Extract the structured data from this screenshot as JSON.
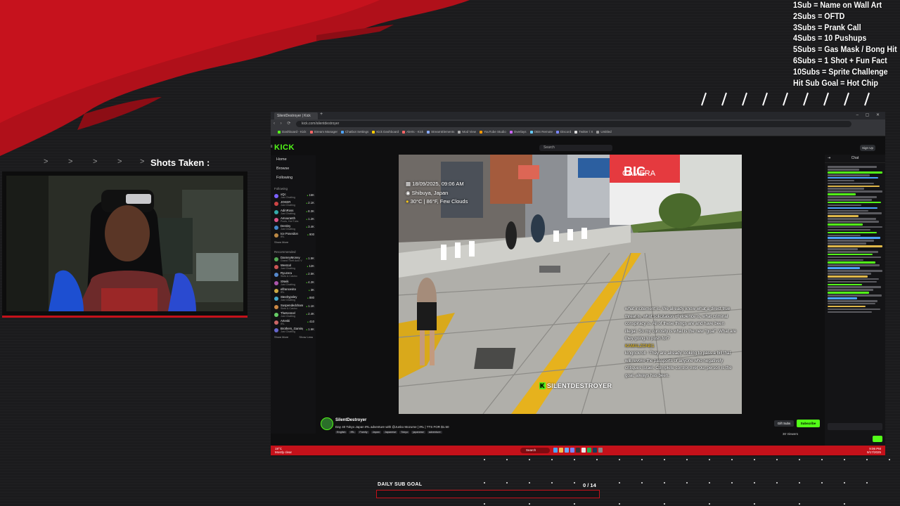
{
  "overlay": {
    "sub_menu": [
      "1Sub = Name on Wall Art",
      "2Subs = OFTD",
      "3Subs = Prank Call",
      "4Subs = 10 Pushups",
      "5Subs = Gas Mask / Bong Hit",
      "6Subs = 1 Shot + Fun Fact",
      "10Subs =  Sprite Challenge",
      "Hit Sub Goal  = Hot Chip"
    ],
    "shots_label": "Shots Taken :",
    "goal_label": "DAILY SUB GOAL",
    "goal_count": "0 / 14",
    "goal_current": 0,
    "goal_target": 14,
    "accent_color": "#c4111a"
  },
  "browser": {
    "tab_title": "SilentDestroyer | Kick",
    "url": "kick.com/silentdestroyer",
    "bookmarks": [
      "Dashboard - Kick",
      "Stream Manager",
      "Chatbot Settings",
      "Kick Dashboard",
      "Alerts - Kick",
      "StreamElements",
      "Mod View",
      "YouTube Studio",
      "Overlays",
      "OBS Remote",
      "Discord",
      "Twitter / X",
      "Untitled"
    ]
  },
  "kick": {
    "logo": "KICK",
    "search_placeholder": "Search",
    "sign_in": "Sign Up",
    "nav": [
      "Home",
      "Browse",
      "Following"
    ],
    "following_label": "Following",
    "recommended_label": "Recommended",
    "show_more": "Show More",
    "show_less": "Show Less",
    "following": [
      {
        "name": "xQc",
        "game": "Just Chatting",
        "viewers": "16K",
        "color": "#7b61ff"
      },
      {
        "name": "JOKER",
        "game": "Just Chatting",
        "viewers": "2.1K",
        "color": "#c44"
      },
      {
        "name": "AdinRoss",
        "game": "Just Chatting",
        "viewers": "8.3K",
        "color": "#3aa"
      },
      {
        "name": "Amouranth",
        "game": "Pools, Hot Tubs",
        "viewers": "1.2K",
        "color": "#d58"
      },
      {
        "name": "Destiny",
        "game": "Just Chatting",
        "viewers": "3.4K",
        "color": "#48c"
      },
      {
        "name": "Ice Poseidon",
        "game": "IRL",
        "viewers": "900",
        "color": "#b84"
      }
    ],
    "recommended": [
      {
        "name": "DanneyMoney",
        "game": "Grand Theft Auto V",
        "viewers": "1.5K",
        "color": "#5a5"
      },
      {
        "name": "Westcol",
        "game": "Just Chatting",
        "viewers": "12K",
        "color": "#c55"
      },
      {
        "name": "Ryuzera",
        "game": "Slots & Casino",
        "viewers": "2.5K",
        "color": "#58c"
      },
      {
        "name": "SNeik",
        "game": "Just Chatting",
        "viewers": "4.2K",
        "color": "#a5a"
      },
      {
        "name": "elfrancesito",
        "game": "IRL",
        "viewers": "3K",
        "color": "#ca4"
      },
      {
        "name": "Steelrypsley",
        "game": "Just Chatting",
        "viewers": "880",
        "color": "#4ac"
      },
      {
        "name": "Suspendedchannel",
        "game": "Slots & Casino",
        "viewers": "1.1K",
        "color": "#c84"
      },
      {
        "name": "TheKennel",
        "game": "Just Chatting",
        "viewers": "2.4K",
        "color": "#6c6"
      },
      {
        "name": "Arteski",
        "game": "IRL",
        "viewers": "410",
        "color": "#c66"
      },
      {
        "name": "Brothers_Gaming",
        "game": "Just Chatting",
        "viewers": "1.6K",
        "color": "#66c"
      }
    ],
    "video": {
      "date_time": "18/09/2025, 09:06 AM",
      "location": "Shibuya, Japan",
      "weather": "30°C | 86°F, Few Clouds",
      "watermark": "SILENTDESTROYER",
      "caption_lines": [
        {
          "user": "",
          "text": "what incitement is. We already know what a direct true threat is, what solicitation of violence is, what criminal conspiracy is. All of these things are and have been illegal. So my curiosity is what is the new \"goal\". What are they going to push for?"
        },
        {
          "user": "KAMALZONE1",
          "text": ""
        },
        {
          "user": "",
          "text": "kingrickroll : They are already looking to pass a bill that will revoke the passports of anyone who negatively critiques Israel. Complete control over our person is the goal, always has been."
        }
      ],
      "storefront": "CAMERA"
    },
    "streamer": {
      "name": "SilentDestroyer",
      "title": "Day 40 Tokyo Japan IRL adventure with @Junko Mozume | IRL | TTS FOR $1.50",
      "tags": [
        "English",
        "IRL",
        "Family",
        "Japan",
        "Japanese",
        "Tokyo",
        "japanese",
        "adventure"
      ],
      "gift": "Gift Subs",
      "subscribe": "Subscribe",
      "viewers": "30 Viewers"
    },
    "chat_title": "Chat"
  },
  "taskbar": {
    "weather": "Mostly clear",
    "temp": "19°C",
    "search": "Search",
    "time": "9:06 PM",
    "date": "9/17/2025"
  }
}
